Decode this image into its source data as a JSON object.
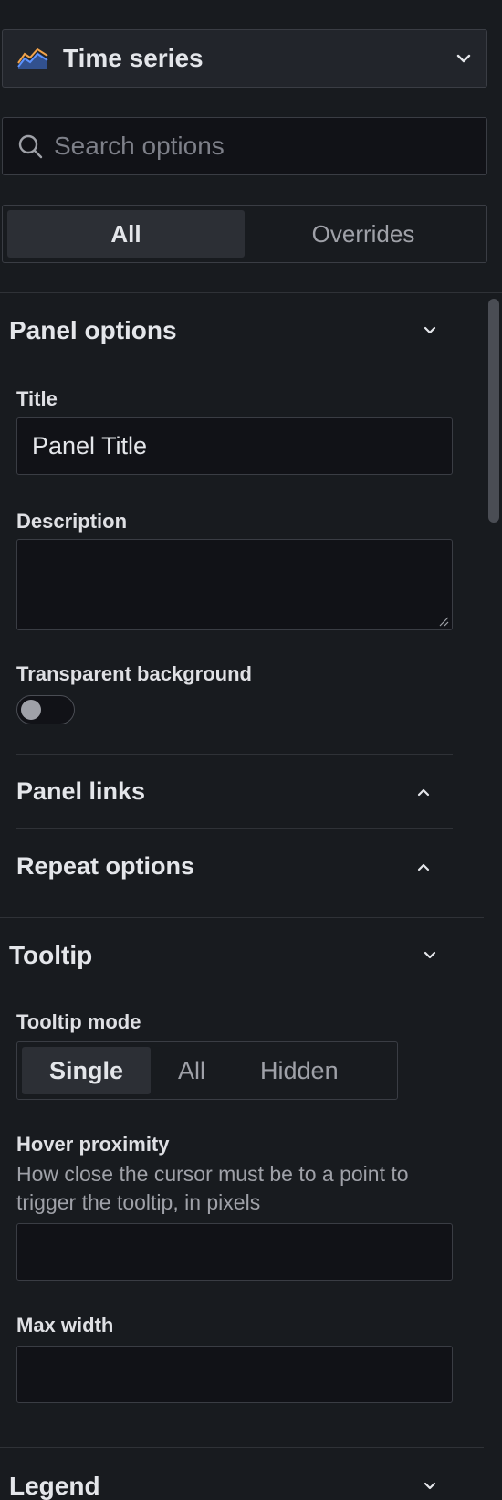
{
  "visualization": {
    "name": "Time series",
    "icon": "time-series-icon"
  },
  "search": {
    "placeholder": "Search options",
    "value": ""
  },
  "tabs": [
    {
      "label": "All",
      "active": true
    },
    {
      "label": "Overrides",
      "active": false
    }
  ],
  "panel_options": {
    "title": "Panel options",
    "expanded": true,
    "title_field": {
      "label": "Title",
      "value": "Panel Title"
    },
    "description_field": {
      "label": "Description",
      "value": ""
    },
    "transparent": {
      "label": "Transparent background",
      "value": false
    },
    "panel_links": {
      "title": "Panel links",
      "expanded": false
    },
    "repeat_options": {
      "title": "Repeat options",
      "expanded": false
    }
  },
  "tooltip": {
    "title": "Tooltip",
    "expanded": true,
    "mode": {
      "label": "Tooltip mode",
      "options": [
        "Single",
        "All",
        "Hidden"
      ],
      "selected": "Single"
    },
    "hover_proximity": {
      "label": "Hover proximity",
      "description": "How close the cursor must be to a point to trigger the tooltip, in pixels",
      "value": ""
    },
    "max_width": {
      "label": "Max width",
      "value": ""
    }
  },
  "legend": {
    "title": "Legend",
    "expanded": true
  },
  "colors": {
    "background": "#181b1f",
    "input_bg": "#111217",
    "border": "#3a3d44",
    "active_tab": "#2c2f35",
    "text": "#e4e6ea",
    "muted": "#9fa1a8"
  }
}
